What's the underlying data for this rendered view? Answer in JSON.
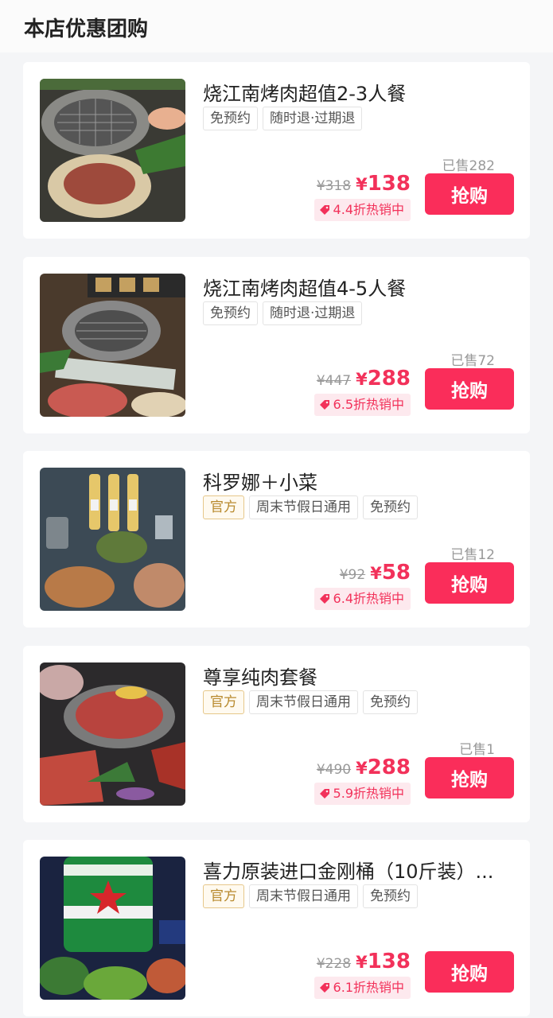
{
  "header": {
    "title": "本店优惠团购"
  },
  "deals": [
    {
      "title": "烧江南烤肉超值2-3人餐",
      "tags": [
        "免预约",
        "随时退·过期退"
      ],
      "official": false,
      "sold": "已售282",
      "orig_price": "¥318",
      "price": "138",
      "discount": "4.4折热销中",
      "buy": "抢购",
      "image": "bbq-grill-photo"
    },
    {
      "title": "烧江南烤肉超值4-5人餐",
      "tags": [
        "免预约",
        "随时退·过期退"
      ],
      "official": false,
      "sold": "已售72",
      "orig_price": "¥447",
      "price": "288",
      "discount": "6.5折热销中",
      "buy": "抢购",
      "image": "bbq-spread-photo"
    },
    {
      "title": "科罗娜＋小菜",
      "tags": [
        "官方",
        "周末节假日通用",
        "免预约"
      ],
      "official": true,
      "sold": "已售12",
      "orig_price": "¥92",
      "price": "58",
      "discount": "6.4折热销中",
      "buy": "抢购",
      "image": "beer-snacks-photo"
    },
    {
      "title": "尊享纯肉套餐",
      "tags": [
        "官方",
        "周末节假日通用",
        "免预约"
      ],
      "official": true,
      "sold": "已售1",
      "orig_price": "¥490",
      "price": "288",
      "discount": "5.9折热销中",
      "buy": "抢购",
      "image": "meat-platter-photo"
    },
    {
      "title": "喜力原装进口金刚桶（10斤装）...",
      "tags": [
        "官方",
        "周末节假日通用",
        "免预约"
      ],
      "official": true,
      "sold": "",
      "orig_price": "¥228",
      "price": "138",
      "discount": "6.1折热销中",
      "buy": "抢购",
      "image": "heineken-keg-photo"
    }
  ],
  "colors": {
    "accent": "#fa2d5a",
    "price": "#f2315a",
    "official": "#b88a2e"
  }
}
